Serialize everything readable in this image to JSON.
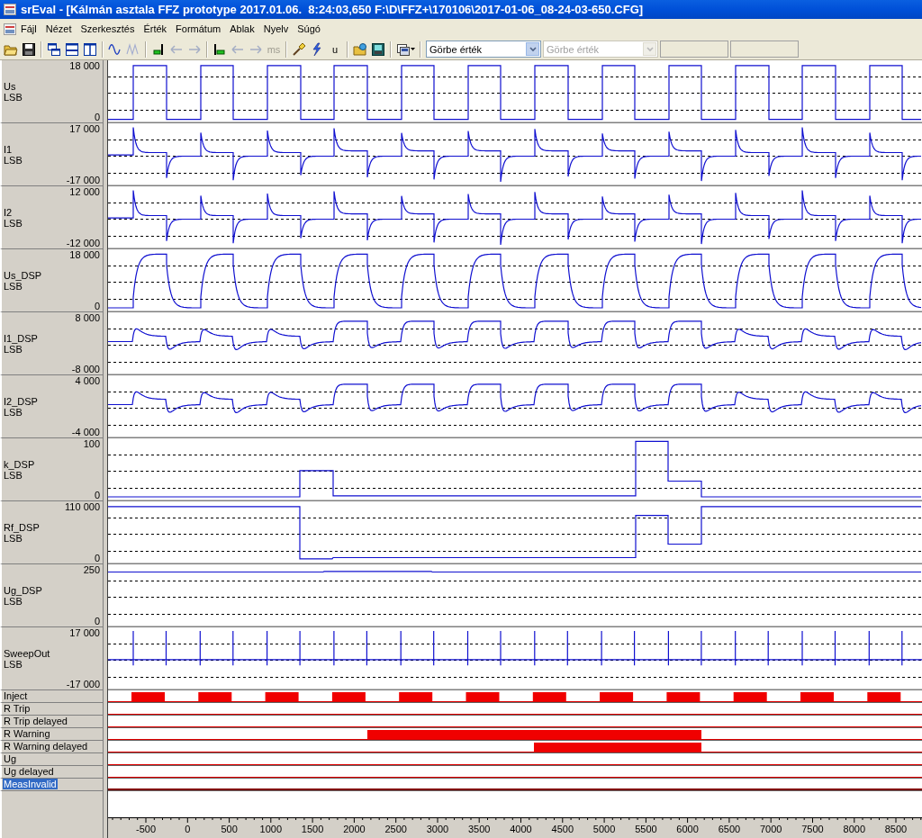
{
  "window": {
    "title": "srEval - [Kálmán asztala FFZ prototype 2017.01.06.  8:24:03,650 F:\\D\\FFZ+\\170106\\2017-01-06_08-24-03-650.CFG]"
  },
  "menu": [
    "Fájl",
    "Nézet",
    "Szerkesztés",
    "Érték",
    "Formátum",
    "Ablak",
    "Nyelv",
    "Súgó"
  ],
  "toolbar": {
    "groups": [
      [
        {
          "disabled": false
        },
        {
          "disabled": false
        }
      ],
      [
        {
          "disabled": false
        },
        {
          "disabled": false
        },
        {
          "disabled": false
        }
      ],
      [
        {
          "disabled": false
        },
        {
          "disabled": true
        }
      ],
      [
        {
          "disabled": false
        },
        {
          "disabled": true
        },
        {
          "disabled": true
        }
      ],
      [
        {
          "disabled": false
        },
        {
          "disabled": true
        },
        {
          "disabled": true
        },
        {
          "label": "ms",
          "disabled": true
        }
      ],
      [
        {
          "disabled": false
        },
        {
          "disabled": false
        },
        {
          "label": "u",
          "disabled": false
        }
      ],
      [
        {
          "disabled": false
        },
        {
          "disabled": false
        }
      ],
      [
        {
          "disabled": false
        }
      ]
    ],
    "combos": [
      {
        "value": "Görbe érték",
        "disabled": false
      },
      {
        "value": "Görbe érték",
        "disabled": true
      }
    ]
  },
  "analog_channels": [
    {
      "name": "Us",
      "unit": "LSB",
      "max": "18 000",
      "min": "0",
      "kind": "square"
    },
    {
      "name": "I1",
      "unit": "LSB",
      "max": "17 000",
      "min": "-17 000",
      "kind": "transient"
    },
    {
      "name": "I2",
      "unit": "LSB",
      "max": "12 000",
      "min": "-12 000",
      "kind": "transient"
    },
    {
      "name": "Us_DSP",
      "unit": "LSB",
      "max": "18 000",
      "min": "0",
      "kind": "smoothed-square"
    },
    {
      "name": "I1_DSP",
      "unit": "LSB",
      "max": "8 000",
      "min": "-8 000",
      "kind": "smoothed-transient"
    },
    {
      "name": "I2_DSP",
      "unit": "LSB",
      "max": "4 000",
      "min": "-4 000",
      "kind": "smoothed-transient"
    },
    {
      "name": "k_DSP",
      "unit": "LSB",
      "max": "100",
      "min": "0",
      "kind": "step-up"
    },
    {
      "name": "Rf_DSP",
      "unit": "LSB",
      "max": "110 000",
      "min": "0",
      "kind": "step-down"
    },
    {
      "name": "Ug_DSP",
      "unit": "LSB",
      "max": "250",
      "min": "0",
      "kind": "flat"
    },
    {
      "name": "SweepOut",
      "unit": "LSB",
      "max": "17 000",
      "min": "-17 000",
      "kind": "sweep"
    }
  ],
  "digital_channels": [
    {
      "name": "Inject",
      "kind": "periodic",
      "selected": false
    },
    {
      "name": "R Trip",
      "kind": "idle",
      "selected": false
    },
    {
      "name": "R Trip delayed",
      "kind": "idle",
      "selected": false
    },
    {
      "name": "R Warning",
      "kind": "warning",
      "selected": false
    },
    {
      "name": "R Warning delayed",
      "kind": "warning-delayed",
      "selected": false
    },
    {
      "name": "Ug",
      "kind": "idle",
      "selected": false
    },
    {
      "name": "Ug delayed",
      "kind": "idle",
      "selected": false
    },
    {
      "name": "MeasInvalid",
      "kind": "idle",
      "selected": true
    }
  ],
  "x_axis": {
    "labels": [
      "-500",
      "0",
      "500",
      "1000",
      "1500",
      "2000",
      "2500",
      "3000",
      "3500",
      "4000",
      "4500",
      "5000",
      "5500",
      "6000",
      "6500",
      "7000",
      "7500",
      "8000",
      "8500"
    ]
  }
}
